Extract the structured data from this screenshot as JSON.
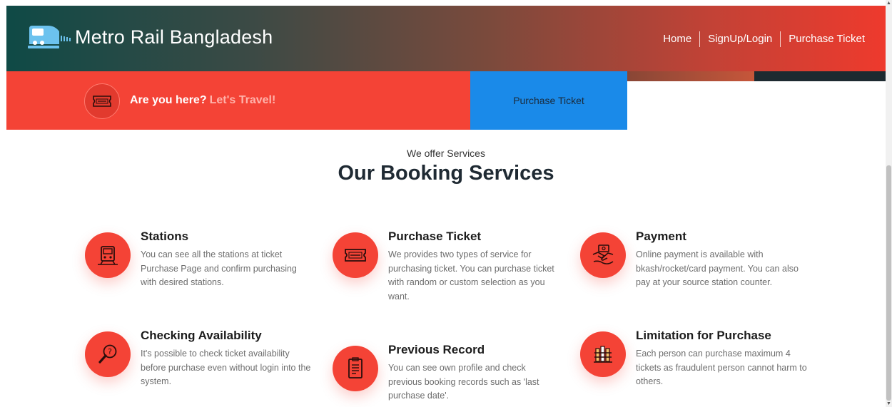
{
  "header": {
    "brand_name": "Metro Rail Bangladesh",
    "brand_icon": "train-icon",
    "nav": [
      {
        "label": "Home"
      },
      {
        "label": "SignUp/Login"
      },
      {
        "label": "Purchase Ticket"
      }
    ]
  },
  "cta": {
    "icon": "ticket-icon",
    "text_bold": "Are you here?",
    "text_accent": "Let's Travel!",
    "button_label": "Purchase Ticket"
  },
  "services_section": {
    "eyebrow": "We offer Services",
    "title": "Our Booking Services",
    "items": [
      {
        "title": "Stations",
        "icon": "station-board-icon",
        "desc": "You can see all the stations at ticket Purchase Page and confirm purchasing with desired stations."
      },
      {
        "title": "Purchase Ticket",
        "icon": "ticket-icon",
        "desc": "We provides two types of service for purchasing ticket. You can purchase ticket with random or custom selection as you want."
      },
      {
        "title": "Payment",
        "icon": "payment-handshake-icon",
        "desc": "Online payment is available with bkash/rocket/card payment. You can also pay at your source station counter."
      },
      {
        "title": "Checking Availability",
        "icon": "search-magnifier-icon",
        "desc": "It's possible to check ticket availability before purchase even without login into the system."
      },
      {
        "title": "Previous Record",
        "icon": "document-record-icon",
        "desc": "You can see own profile and check previous booking records such as 'last purchase date'."
      },
      {
        "title": "Limitation for Purchase",
        "icon": "limit-barrier-icon",
        "desc": "Each person can purchase maximum 4 tickets as fraudulent person cannot harm to others."
      }
    ]
  },
  "colors": {
    "accent_red": "#f44336",
    "cta_blue": "#1a8ae9",
    "header_green": "#0f4a46"
  }
}
